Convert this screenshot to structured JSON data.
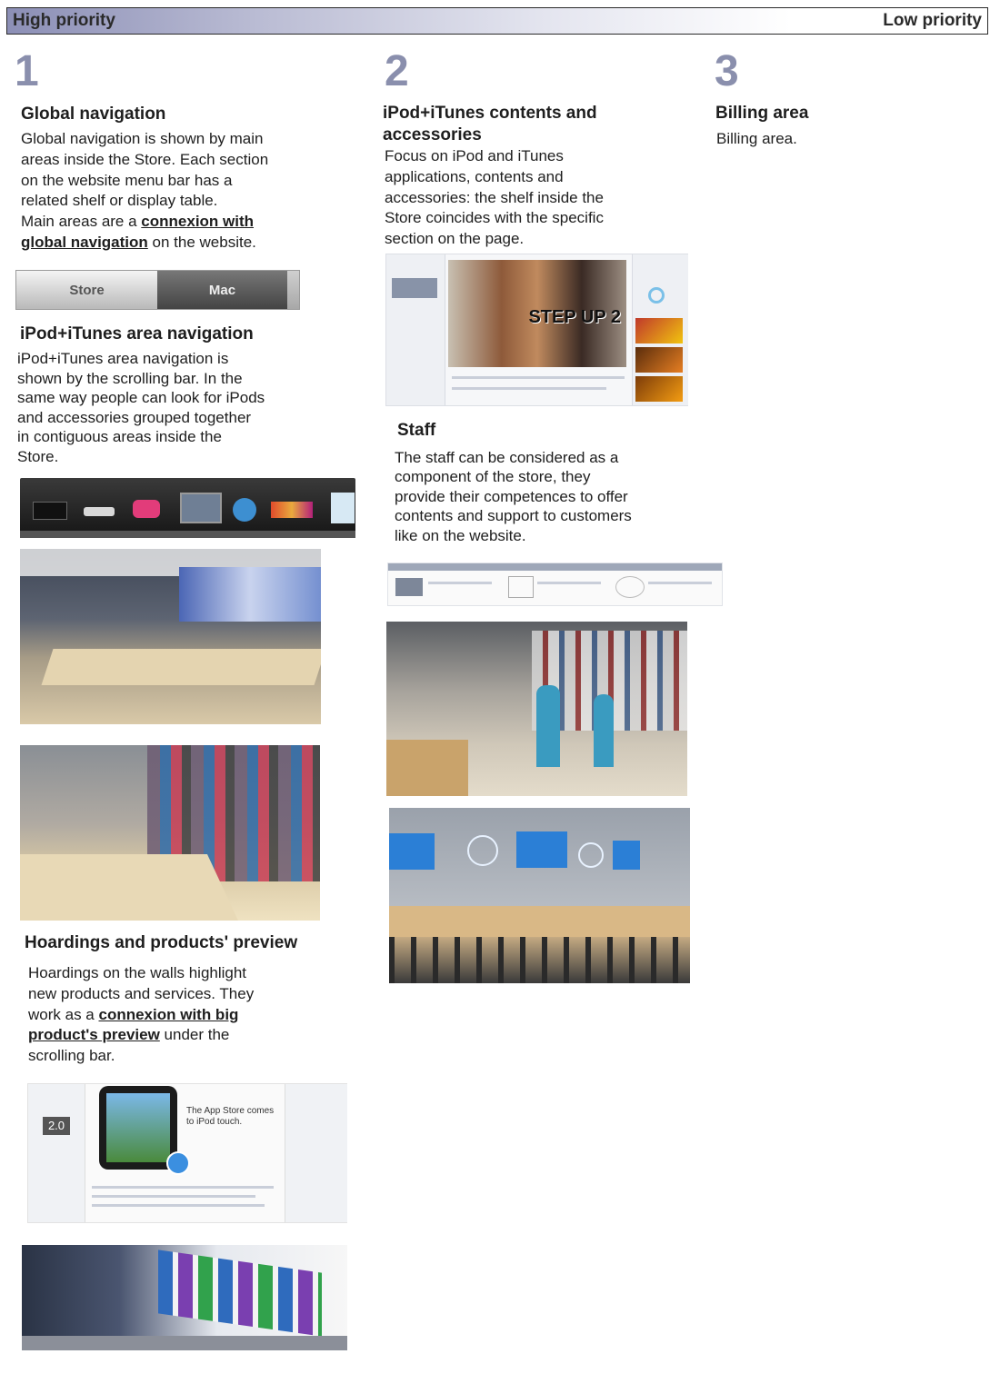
{
  "header": {
    "left": "High priority",
    "right": "Low priority"
  },
  "columns": [
    {
      "number": "1"
    },
    {
      "number": "2"
    },
    {
      "number": "3"
    }
  ],
  "global_nav": {
    "title": "Global navigation",
    "lines": [
      "Global navigation is shown by main",
      "areas inside the Store. Each section",
      "on the website menu bar has a",
      "related shelf or display table."
    ],
    "line5_pre": "Main areas are a ",
    "link_part1": "connexion with",
    "link_part2": "global navigation",
    "line6_post": " on the website.",
    "tab_store": "Store",
    "tab_mac": "Mac"
  },
  "ipod_nav": {
    "title": "iPod+iTunes area navigation",
    "lines": [
      "iPod+iTunes area navigation is",
      "shown by the scrolling bar. In the",
      "same way people can look for iPods",
      "and accessories grouped together",
      "in contiguous areas inside the",
      "Store."
    ]
  },
  "hoardings": {
    "title": "Hoardings and products' preview",
    "lines": [
      "Hoardings on the walls highlight",
      "new products and services. They"
    ],
    "line3_pre": "work as a ",
    "link_part1": "connexion with big",
    "link_part2": "product's preview",
    "line4_post": " under the",
    "line5": "scrolling bar.",
    "thumb_version": "2.0",
    "thumb_headline1": "The App Store comes",
    "thumb_headline2": "to iPod touch."
  },
  "contents": {
    "title_line1": "iPod+iTunes contents and",
    "title_line2": "accessories",
    "lines": [
      "Focus on iPod and iTunes",
      "applications, contents and",
      "accessories: the shelf inside the",
      "Store coincides with the specific",
      "section on the page."
    ],
    "poster_text": "STEP UP 2"
  },
  "staff": {
    "title": "Staff",
    "lines": [
      "The staff can be considered as a",
      "component of the store, they",
      "provide their competences to offer",
      "contents and support to customers",
      "like on the website."
    ]
  },
  "billing": {
    "title": "Billing area",
    "text": "Billing area."
  },
  "colors": {
    "accent_number": "#8a8fad",
    "header_gradient_start": "#8c8fb6",
    "tab_active": "#5a5a5a"
  }
}
